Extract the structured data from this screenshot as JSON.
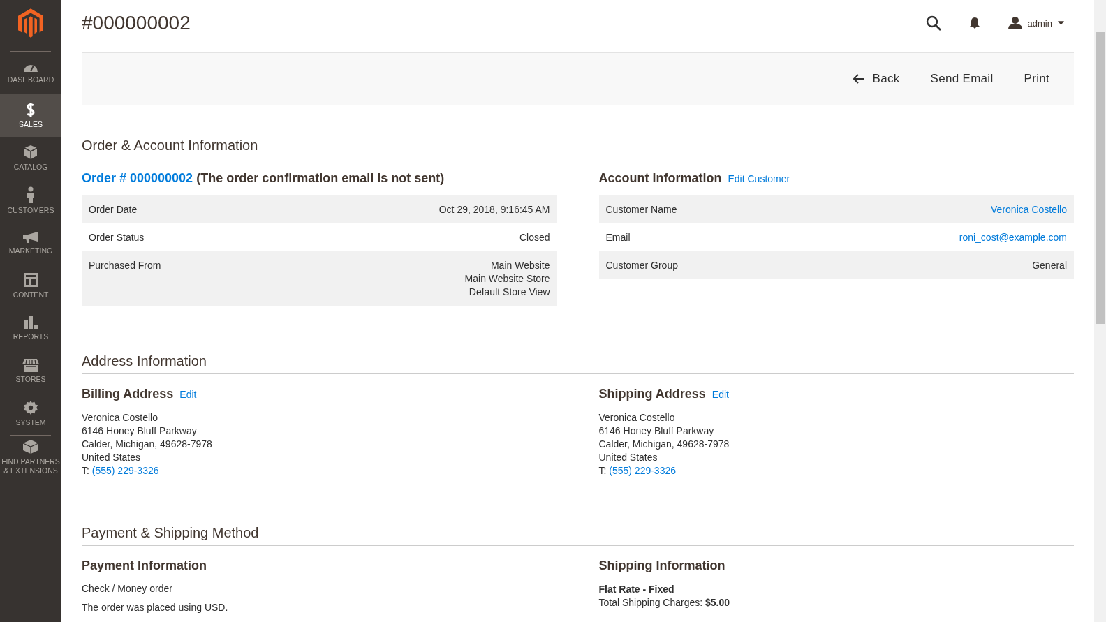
{
  "sidebar": {
    "items": [
      {
        "label": "DASHBOARD",
        "kind": "dashboard",
        "selected": false
      },
      {
        "label": "SALES",
        "kind": "sales",
        "selected": true
      },
      {
        "label": "CATALOG",
        "kind": "catalog",
        "selected": false
      },
      {
        "label": "CUSTOMERS",
        "kind": "customers",
        "selected": false
      },
      {
        "label": "MARKETING",
        "kind": "marketing",
        "selected": false
      },
      {
        "label": "CONTENT",
        "kind": "content",
        "selected": false
      },
      {
        "label": "REPORTS",
        "kind": "reports",
        "selected": false
      },
      {
        "label": "STORES",
        "kind": "stores",
        "selected": false
      },
      {
        "label": "SYSTEM",
        "kind": "system",
        "selected": false
      },
      {
        "label": "FIND PARTNERS & EXTENSIONS",
        "kind": "partners",
        "selected": false
      }
    ]
  },
  "header": {
    "title": "#000000002",
    "user": "admin"
  },
  "actions": {
    "back": "Back",
    "buttons": [
      "Send Email",
      "Print"
    ]
  },
  "order_account": {
    "title": "Order & Account Information",
    "order": {
      "link": "Order # 000000002",
      "note": "(The order confirmation email is not sent)",
      "rows": [
        {
          "label": "Order Date",
          "value": [
            "Oct 29, 2018, 9:16:45 AM"
          ]
        },
        {
          "label": "Order Status",
          "value": [
            "Closed"
          ]
        },
        {
          "label": "Purchased From",
          "value": [
            "Main Website",
            "Main Website Store",
            "Default Store View"
          ]
        }
      ]
    },
    "account": {
      "title": "Account Information",
      "edit": "Edit Customer",
      "rows": [
        {
          "label": "Customer Name",
          "value": "Veronica Costello",
          "link": true
        },
        {
          "label": "Email",
          "value": "roni_cost@example.com",
          "link": true
        },
        {
          "label": "Customer Group",
          "value": "General",
          "link": false
        }
      ]
    }
  },
  "address": {
    "title": "Address Information",
    "blocks": [
      {
        "title": "Billing Address",
        "edit": "Edit",
        "lines": [
          "Veronica Costello",
          "6146 Honey Bluff Parkway",
          "Calder, Michigan, 49628-7978",
          "United States"
        ],
        "phone_prefix": "T:",
        "phone": "(555) 229-3326"
      },
      {
        "title": "Shipping Address",
        "edit": "Edit",
        "lines": [
          "Veronica Costello",
          "6146 Honey Bluff Parkway",
          "Calder, Michigan, 49628-7978",
          "United States"
        ],
        "phone_prefix": "T:",
        "phone": "(555) 229-3326"
      }
    ]
  },
  "payment_shipping": {
    "title": "Payment & Shipping Method",
    "payment": {
      "title": "Payment Information",
      "method": "Check / Money order",
      "note": "The order was placed using USD."
    },
    "shipping": {
      "title": "Shipping Information",
      "method": "Flat Rate - Fixed",
      "charges": "Total Shipping Charges: **$5.00**"
    }
  }
}
